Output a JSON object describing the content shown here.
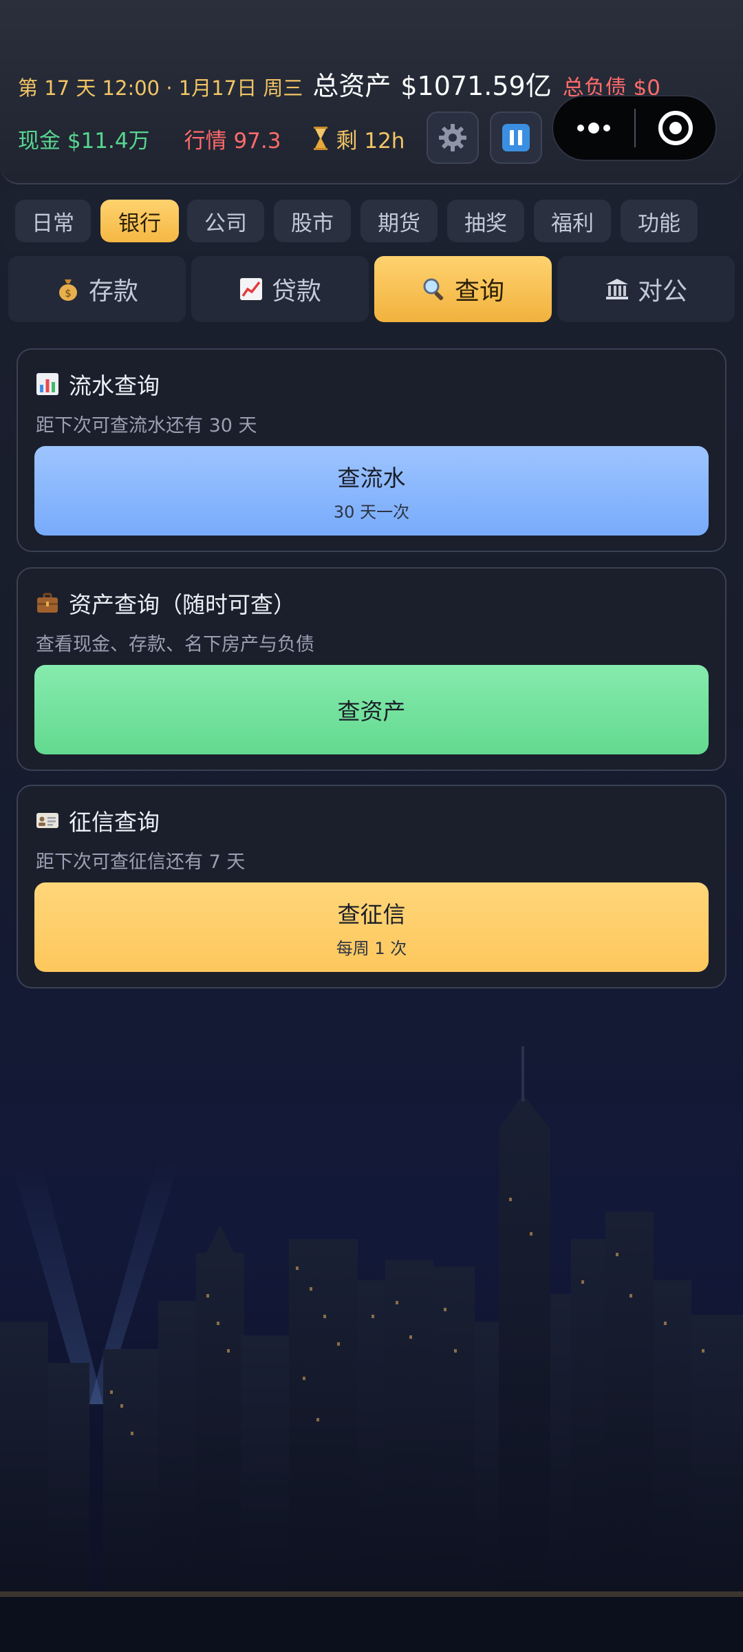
{
  "header": {
    "day_time": "第 17 天 12:00 · 1月17日 周三",
    "total_assets_label": "总资产",
    "total_assets_value": "$1071.59亿",
    "debt_text": "总负债 $0",
    "cash_text": "现金 $11.4万",
    "market_text": "行情 97.3",
    "remaining_text": "剩 12h",
    "icons": {
      "remaining": "hourglass-icon",
      "settings": "gear-icon",
      "pause": "pause-icon",
      "more": "more-dots-icon",
      "close": "target-close-icon"
    }
  },
  "category_tabs": [
    {
      "label": "日常"
    },
    {
      "label": "银行",
      "active": true
    },
    {
      "label": "公司"
    },
    {
      "label": "股市"
    },
    {
      "label": "期货"
    },
    {
      "label": "抽奖"
    },
    {
      "label": "福利"
    },
    {
      "label": "功能"
    }
  ],
  "sub_tabs": [
    {
      "label": "存款",
      "icon": "money-bag-icon"
    },
    {
      "label": "贷款",
      "icon": "chart-up-icon"
    },
    {
      "label": "查询",
      "icon": "magnifier-icon",
      "active": true
    },
    {
      "label": "对公",
      "icon": "bank-icon"
    }
  ],
  "cards": [
    {
      "title": "流水查询",
      "icon": "bar-chart-icon",
      "desc": "距下次可查流水还有 30 天",
      "button": {
        "label": "查流水",
        "sub": "30 天一次"
      }
    },
    {
      "title": "资产查询（随时可查）",
      "icon": "briefcase-icon",
      "desc": "查看现金、存款、名下房产与负债",
      "button": {
        "label": "查资产",
        "sub": ""
      }
    },
    {
      "title": "征信查询",
      "icon": "id-card-icon",
      "desc": "距下次可查征信还有 7 天",
      "button": {
        "label": "查征信",
        "sub": "每周 1 次"
      }
    }
  ],
  "colors": {
    "accent_yellow": "#f5b844",
    "gain_green": "#58d690",
    "loss_red": "#ff6b6b",
    "blue_button": "#78abfb",
    "green_button": "#63d98f",
    "yellow_button": "#fdc75c"
  }
}
